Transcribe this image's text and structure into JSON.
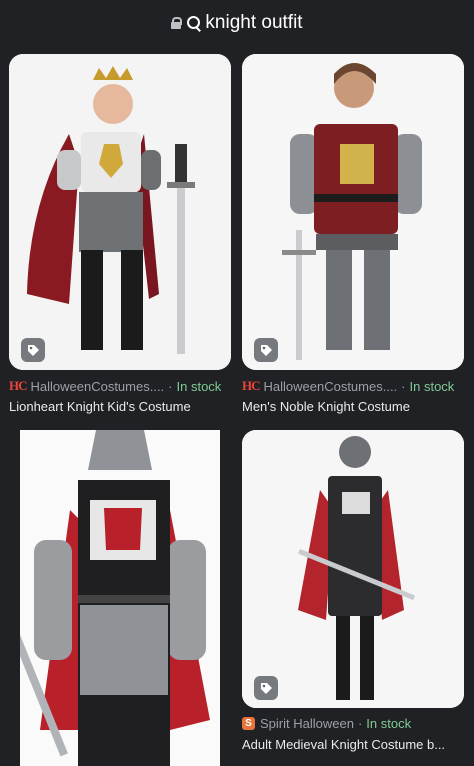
{
  "search": {
    "query": "knight outfit"
  },
  "results": [
    {
      "source": "HalloweenCostumes....",
      "availability": "In stock",
      "title": "Lionheart Knight Kid's Costume",
      "favicon": "halloweencostumes-logo"
    },
    {
      "source": "HalloweenCostumes....",
      "availability": "In stock",
      "title": "Men's Noble Knight Costume",
      "favicon": "halloweencostumes-logo"
    },
    {
      "source": "",
      "availability": "",
      "title": "",
      "favicon": ""
    },
    {
      "source": "Spirit Halloween",
      "availability": "In stock",
      "title": "Adult Medieval Knight Costume b...",
      "favicon": "spirit-halloween-logo"
    }
  ],
  "colors": {
    "background": "#202124",
    "in_stock": "#81c995",
    "secondary_text": "#9aa0a6"
  },
  "icons": [
    "lock-icon",
    "search-icon",
    "shopping-tag-icon"
  ]
}
